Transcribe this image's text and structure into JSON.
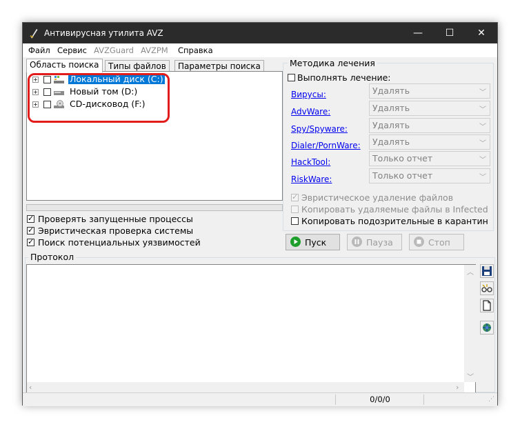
{
  "window": {
    "title": "Антивирусная утилита AVZ",
    "controls": [
      "—",
      "☐",
      "✕"
    ]
  },
  "menu": {
    "items": [
      {
        "label": "Файл",
        "disabled": false
      },
      {
        "label": "Сервис",
        "disabled": false
      },
      {
        "label": "AVZGuard",
        "disabled": true
      },
      {
        "label": "AVZPM",
        "disabled": true
      },
      {
        "label": "Справка",
        "disabled": false
      }
    ]
  },
  "search_panel": {
    "tabs": [
      {
        "label": "Область поиска",
        "active": true
      },
      {
        "label": "Типы файлов",
        "active": false
      },
      {
        "label": "Параметры поиска",
        "active": false
      }
    ],
    "tree": [
      {
        "label": "Локальный диск (C:)",
        "selected": true,
        "icon": "hard-drive-icon"
      },
      {
        "label": "Новый том (D:)",
        "selected": false,
        "icon": "drive-icon"
      },
      {
        "label": "CD-дисковод (F:)",
        "selected": false,
        "icon": "cd-drive-icon"
      }
    ],
    "options": [
      {
        "label": "Проверять запущенные процессы",
        "checked": true
      },
      {
        "label": "Эвристическая проверка системы",
        "checked": true
      },
      {
        "label": "Поиск потенциальных уязвимостей",
        "checked": true
      }
    ]
  },
  "treatment": {
    "title": "Методика лечения",
    "perform_label": "Выполнять лечение:",
    "perform_checked": false,
    "rows": [
      {
        "label": "Вирусы:",
        "value": "Удалять"
      },
      {
        "label": "AdvWare:",
        "value": "Удалять"
      },
      {
        "label": "Spy/Spyware:",
        "value": "Удалять"
      },
      {
        "label": "Dialer/PornWare:",
        "value": "Удалять"
      },
      {
        "label": "HackTool:",
        "value": "Только отчет"
      },
      {
        "label": "RiskWare:",
        "value": "Только отчет"
      }
    ],
    "options": [
      {
        "label": "Эвристическое удаление файлов",
        "checked": true,
        "disabled": true
      },
      {
        "label": "Копировать удаляемые файлы в  Infected",
        "checked": false,
        "disabled": true
      },
      {
        "label": "Копировать подозрительные в  карантин",
        "checked": false,
        "disabled": false
      }
    ]
  },
  "actions": {
    "start": "Пуск",
    "pause": "Пауза",
    "stop": "Стоп"
  },
  "log": {
    "title": "Протокол",
    "side_buttons": [
      "save-icon",
      "glasses-icon",
      "document-icon",
      "network-icon"
    ]
  },
  "status": {
    "counter": "0/0/0"
  },
  "colors": {
    "titlebar": "#2b2b2b",
    "selection": "#0078d7",
    "highlight_box": "#e21b1b",
    "start_icon": "#1e9e2a"
  }
}
